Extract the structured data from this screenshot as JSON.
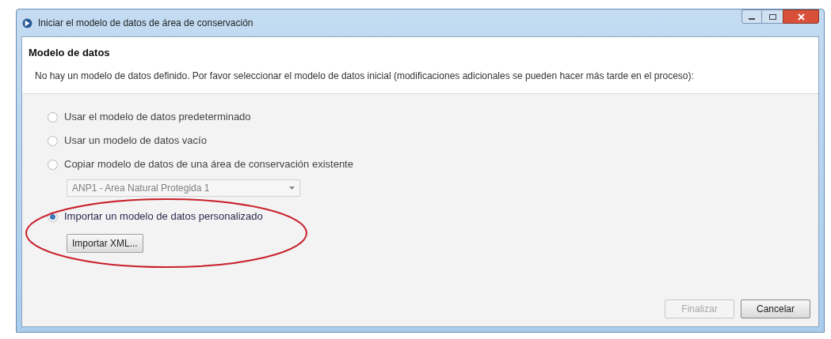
{
  "window": {
    "title": "Iniciar el modelo de datos de área de conservación"
  },
  "header": {
    "title": "Modelo de datos",
    "description": "No hay un modelo de datos definido. Por favor seleccionar el modelo de datos inicial (modificaciones adicionales se pueden hacer más tarde en el proceso):"
  },
  "options": [
    {
      "kind": "radio",
      "label": "Usar el modelo de datos predeterminado",
      "selected": false
    },
    {
      "kind": "radio",
      "label": "Usar un modelo de datos vacío",
      "selected": false
    },
    {
      "kind": "radio",
      "label": "Copiar modelo de datos de una área de conservación existente",
      "selected": false
    },
    {
      "kind": "dropdown",
      "value": "ANP1 - Area Natural Protegida 1",
      "disabled": true
    },
    {
      "kind": "radio",
      "label": "Importar un modelo de datos personalizado",
      "selected": true,
      "highlighted": true
    },
    {
      "kind": "button",
      "label": "Importar XML...",
      "disabled": false
    }
  ],
  "buttons": [
    {
      "label": "Finalizar",
      "disabled": true
    },
    {
      "label": "Cancelar",
      "disabled": false
    }
  ]
}
